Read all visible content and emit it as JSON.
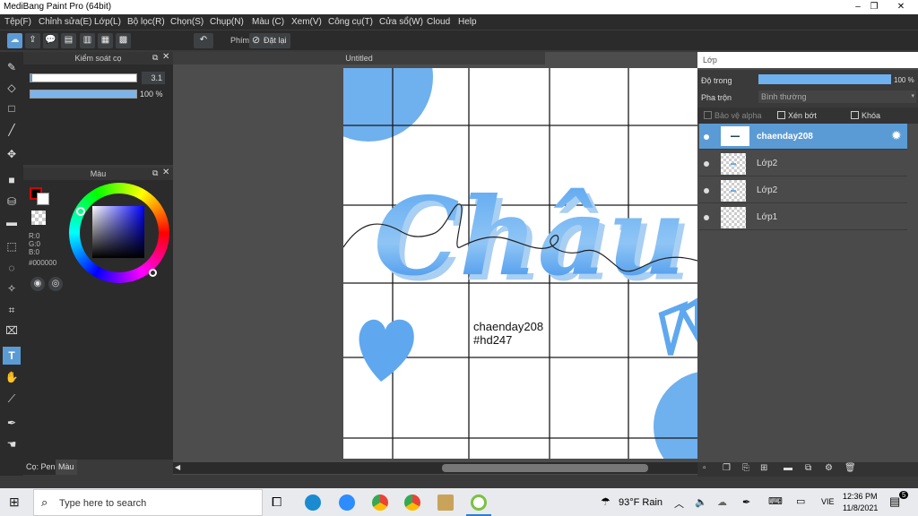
{
  "window": {
    "title": "MediBang Paint Pro (64bit)"
  },
  "menu": [
    "Tệp(F)",
    "Chỉnh sửa(E)",
    "Lớp(L)",
    "Bộ lọc(R)",
    "Chọn(S)",
    "Chụp(N)",
    "Màu (C)",
    "Xem(V)",
    "Công cụ(T)",
    "Cửa sổ(W)",
    "Cloud",
    "Help"
  ],
  "toolbar": {
    "phim_label": "Phím",
    "reset_label": "Đặt lại"
  },
  "brush_panel": {
    "title": "Kiểm soát cọ",
    "size": "3.1",
    "opacity": "100 %",
    "size_fill": 0.97,
    "opacity_fill": 1.0
  },
  "color_panel": {
    "title": "Màu",
    "r": "R:0",
    "g": "G:0",
    "b": "B:0",
    "hex": "#000000"
  },
  "left_bottom_tabs": {
    "pen": "Cọ: Pen",
    "color": "Màu"
  },
  "canvas": {
    "tab": "Untitled",
    "text_line1": "chaenday208",
    "text_line2": "#hd247",
    "art_word": "Châu"
  },
  "layers": {
    "title": "Lớp",
    "opacity_label": "Độ trong",
    "opacity_value": "100 %",
    "blend_label": "Pha trộn",
    "blend_value": "Bình thường",
    "protect_alpha": "Bảo vệ alpha",
    "clipping": "Xén bớt",
    "lock": "Khóa",
    "items": [
      {
        "name": "chaenday208",
        "selected": true
      },
      {
        "name": "Lớp2",
        "selected": false
      },
      {
        "name": "Lớp2",
        "selected": false
      },
      {
        "name": "Lớp1",
        "selected": false
      }
    ]
  },
  "taskbar": {
    "search_placeholder": "Type here to search",
    "weather": "93°F Rain",
    "lang": "VIE",
    "time": "12:36 PM",
    "date": "11/8/2021",
    "notif": "5"
  },
  "colors": {
    "accent": "#5b9bd5",
    "art_blue": "#4a9ff0"
  }
}
